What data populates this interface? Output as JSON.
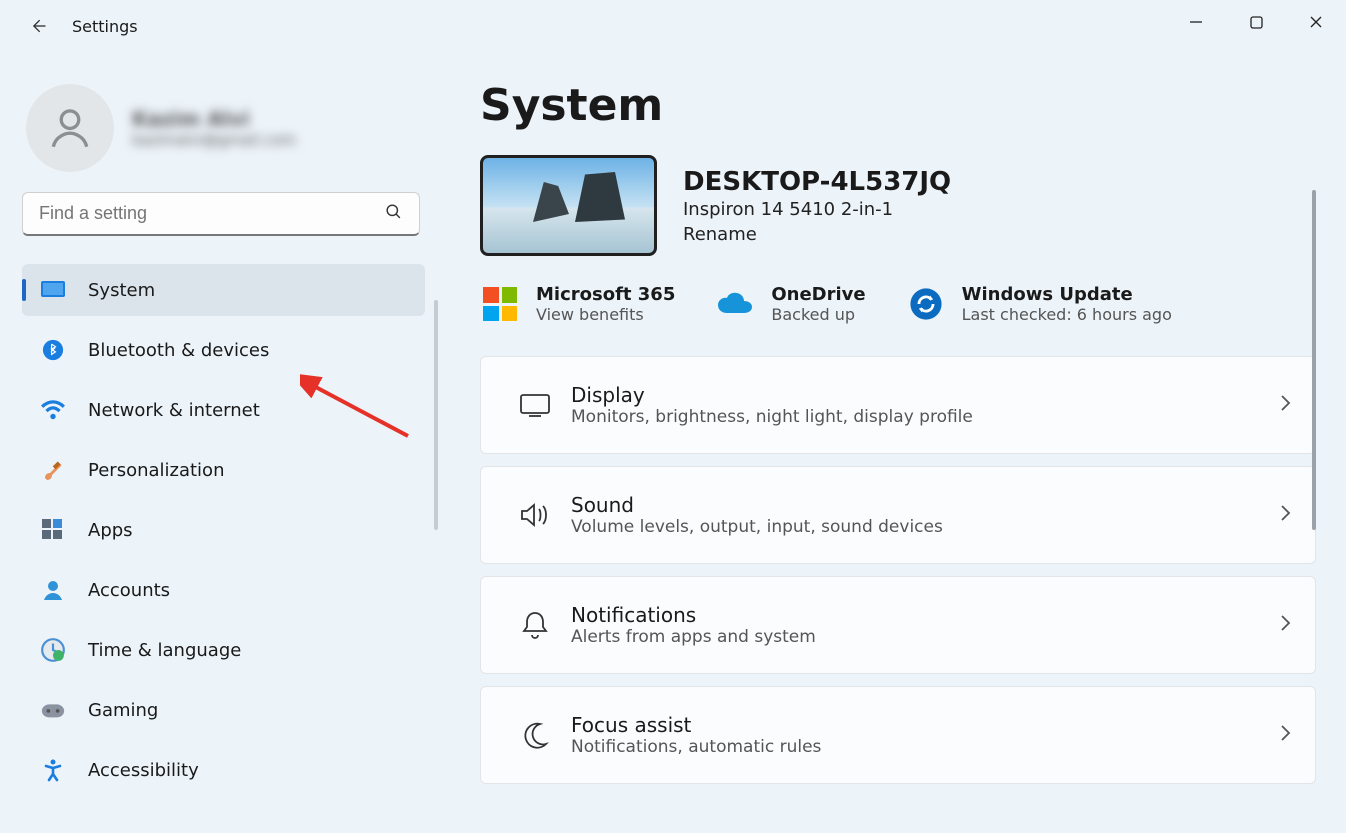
{
  "app": {
    "title": "Settings"
  },
  "user": {
    "name": "Kazim Alvi",
    "email": "kazimalvi@gmail.com"
  },
  "search": {
    "placeholder": "Find a setting"
  },
  "nav": [
    {
      "label": "System",
      "selected": true
    },
    {
      "label": "Bluetooth & devices"
    },
    {
      "label": "Network & internet"
    },
    {
      "label": "Personalization"
    },
    {
      "label": "Apps"
    },
    {
      "label": "Accounts"
    },
    {
      "label": "Time & language"
    },
    {
      "label": "Gaming"
    },
    {
      "label": "Accessibility"
    }
  ],
  "page": {
    "heading": "System",
    "device": {
      "name": "DESKTOP-4L537JQ",
      "model": "Inspiron 14 5410 2-in-1",
      "rename": "Rename"
    },
    "tiles": [
      {
        "title": "Microsoft 365",
        "sub": "View benefits"
      },
      {
        "title": "OneDrive",
        "sub": "Backed up"
      },
      {
        "title": "Windows Update",
        "sub": "Last checked: 6 hours ago"
      }
    ],
    "cards": [
      {
        "title": "Display",
        "sub": "Monitors, brightness, night light, display profile"
      },
      {
        "title": "Sound",
        "sub": "Volume levels, output, input, sound devices"
      },
      {
        "title": "Notifications",
        "sub": "Alerts from apps and system"
      },
      {
        "title": "Focus assist",
        "sub": "Notifications, automatic rules"
      }
    ]
  }
}
